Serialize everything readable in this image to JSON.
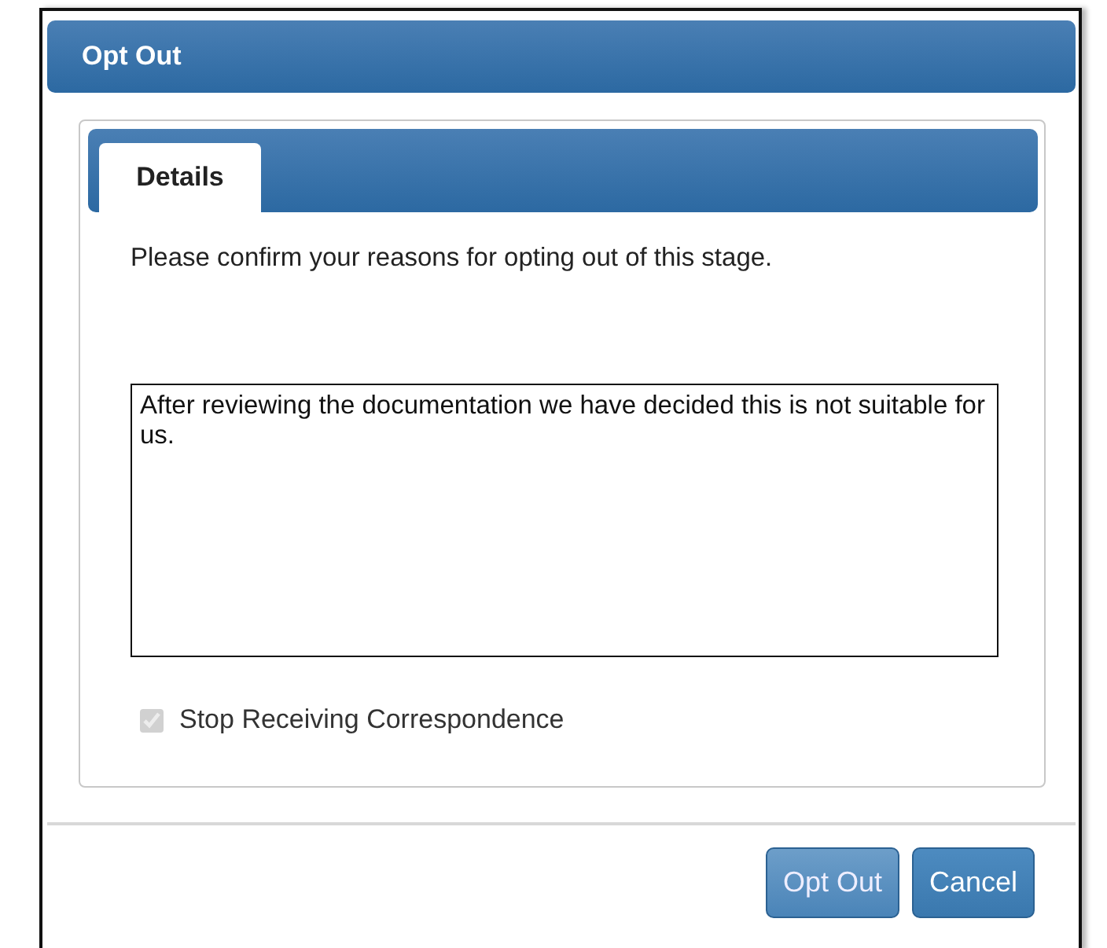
{
  "window": {
    "title": "Opt Out"
  },
  "tabs": [
    {
      "label": "Details",
      "selected": true
    }
  ],
  "prompt": "Please confirm your reasons for opting out of this stage.",
  "reason": {
    "value": "After reviewing the documentation we have decided this is not suitable for us."
  },
  "checkbox": {
    "label": "Stop Receiving Correspondence",
    "checked": true,
    "disabled": true
  },
  "buttons": [
    "Opt Out",
    "Cancel"
  ]
}
